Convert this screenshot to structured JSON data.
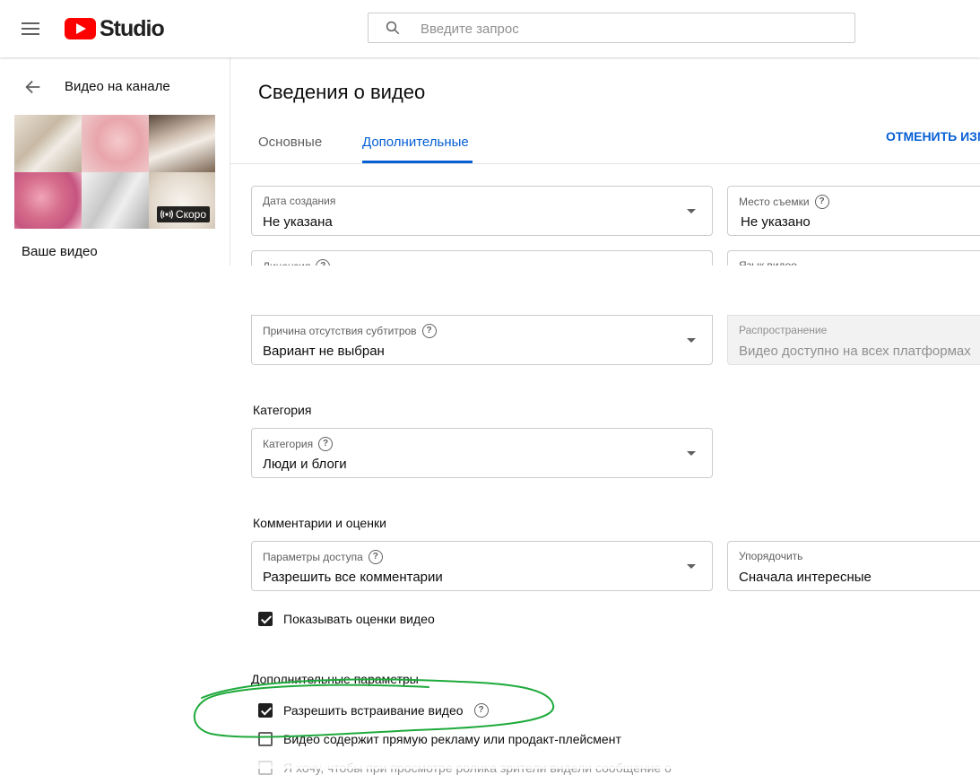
{
  "header": {
    "logo_text": "Studio",
    "search_placeholder": "Введите запрос"
  },
  "sidebar": {
    "back_label": "Видео на канале",
    "thumbnail_badge": "Скоро",
    "your_video_label": "Ваше видео"
  },
  "main": {
    "title": "Сведения о видео",
    "tabs": [
      {
        "label": "Основные"
      },
      {
        "label": "Дополнительные"
      }
    ],
    "undo_button": "ОТМЕНИТЬ ИЗМ",
    "fields": {
      "recording_date": {
        "label": "Дата создания",
        "value": "Не указана"
      },
      "location": {
        "label": "Место съемки",
        "value": "Не указано"
      },
      "license": {
        "label": "Лицензия"
      },
      "language": {
        "label": "Язык видео"
      },
      "caption_reason": {
        "label": "Причина отсутствия субтитров",
        "value": "Вариант не выбран"
      },
      "distribution": {
        "label": "Распространение",
        "value": "Видео доступно на всех платформах"
      },
      "category": {
        "label": "Категория",
        "value": "Люди и блоги"
      },
      "comments_access": {
        "label": "Параметры доступа",
        "value": "Разрешить все комментарии"
      },
      "sort_by": {
        "label": "Упорядочить",
        "value": "Сначала интересные"
      }
    },
    "sections": {
      "category": "Категория",
      "comments": "Комментарии и оценки",
      "advanced": "Дополнительные параметры"
    },
    "checkboxes": {
      "show_ratings": {
        "label": "Показывать оценки видео",
        "checked": true
      },
      "allow_embedding": {
        "label": "Разрешить встраивание видео",
        "checked": true
      },
      "paid_promotion": {
        "label": "Видео содержит прямую рекламу или продакт-плейсмент",
        "checked": false
      },
      "paid_promotion_notice": {
        "label": "Я хочу, чтобы при просмотре ролика зрители видели сообщение о",
        "checked": false
      }
    }
  },
  "colors": {
    "accent": "#065fd4",
    "brand_red": "#ff0000",
    "annotation_green": "#1faa3c"
  }
}
